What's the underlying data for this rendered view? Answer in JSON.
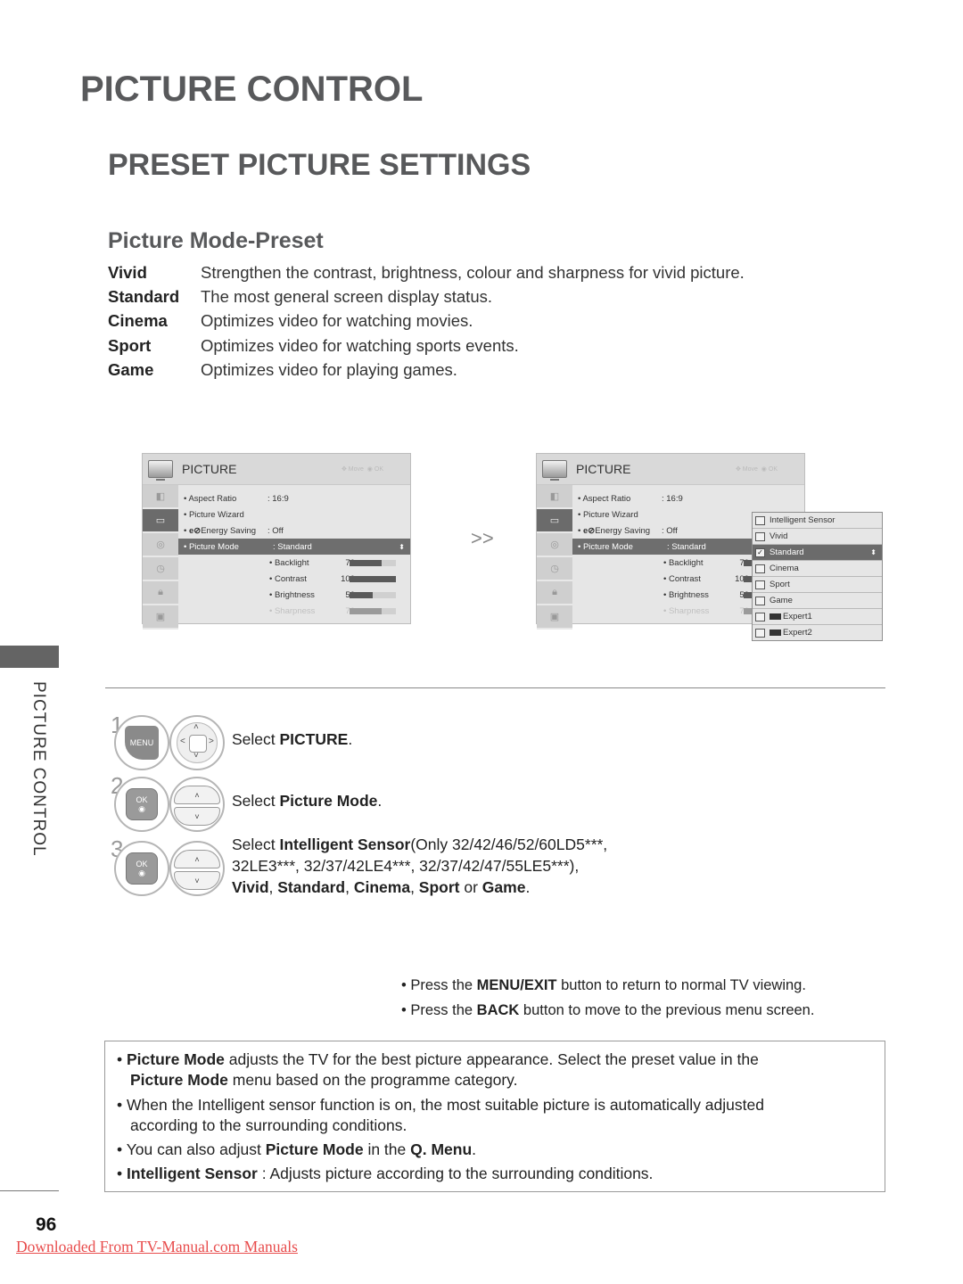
{
  "page": {
    "title": "PICTURE CONTROL",
    "section_title": "PRESET PICTURE SETTINGS",
    "subsection_title": "Picture Mode-Preset",
    "side_label": "PICTURE CONTROL",
    "page_number": "96",
    "footer_link": "Downloaded From TV-Manual.com Manuals"
  },
  "modes": [
    {
      "name": "Vivid",
      "desc": "Strengthen the contrast, brightness, colour and sharpness for vivid picture."
    },
    {
      "name": "Standard",
      "desc": "The most general screen display status."
    },
    {
      "name": "Cinema",
      "desc": "Optimizes video for watching movies."
    },
    {
      "name": "Sport",
      "desc": "Optimizes video for watching sports events."
    },
    {
      "name": "Game",
      "desc": "Optimizes video for playing games."
    }
  ],
  "osd": {
    "title": "PICTURE",
    "hint_move": "Move",
    "hint_ok": "OK",
    "items": [
      {
        "label": "Aspect Ratio",
        "value": ": 16:9"
      },
      {
        "label": "Picture Wizard",
        "value": ""
      },
      {
        "label": "Energy Saving",
        "value": ": Off"
      },
      {
        "label": "Picture Mode",
        "value": ": Standard"
      }
    ],
    "sub_items": [
      {
        "label": "Backlight",
        "value": "70",
        "level": 0.7
      },
      {
        "label": "Contrast",
        "value": "100",
        "level": 1.0
      },
      {
        "label": "Brightness",
        "value": "50",
        "level": 0.5
      },
      {
        "label": "Sharpness",
        "value": "70",
        "level": 0.7
      }
    ]
  },
  "popup": {
    "items": [
      {
        "label": "Intelligent Sensor",
        "checked": false
      },
      {
        "label": "Vivid",
        "checked": false
      },
      {
        "label": "Standard",
        "checked": true
      },
      {
        "label": "Cinema",
        "checked": false
      },
      {
        "label": "Sport",
        "checked": false
      },
      {
        "label": "Game",
        "checked": false
      },
      {
        "label": "Expert1",
        "checked": false
      },
      {
        "label": "Expert2",
        "checked": false
      }
    ]
  },
  "steps": [
    {
      "num": "1",
      "button": "MENU",
      "pre": "Select ",
      "bold": "PICTURE",
      "post": "."
    },
    {
      "num": "2",
      "button": "OK",
      "pre": "Select ",
      "bold": "Picture Mode",
      "post": "."
    },
    {
      "num": "3",
      "button": "OK",
      "line1_pre": "Select ",
      "line1_bold": "Intelligent Sensor",
      "line1_post": "(Only 32/42/46/52/60LD5***,",
      "line2": "32LE3***, 32/37/42LE4***, 32/37/42/47/55LE5***),",
      "line3": [
        {
          "t": "Vivid",
          "b": true
        },
        {
          "t": ", ",
          "b": false
        },
        {
          "t": "Standard",
          "b": true
        },
        {
          "t": ", ",
          "b": false
        },
        {
          "t": "Cinema",
          "b": true
        },
        {
          "t": ", ",
          "b": false
        },
        {
          "t": "Sport",
          "b": true
        },
        {
          "t": " or ",
          "b": false
        },
        {
          "t": "Game",
          "b": true
        },
        {
          "t": ".",
          "b": false
        }
      ]
    }
  ],
  "notes": [
    {
      "pre": "Press the ",
      "bold": "MENU/EXIT",
      "post": " button to return to normal TV viewing."
    },
    {
      "pre": "Press the ",
      "bold": "BACK",
      "post": " button to move to the previous menu screen."
    }
  ],
  "info_box": [
    {
      "parts": [
        {
          "t": "Picture Mode",
          "b": true
        },
        {
          "t": " adjusts the TV for the best picture appearance. Select the preset value in the",
          "b": false
        }
      ]
    },
    {
      "indent": true,
      "parts": [
        {
          "t": "Picture Mode",
          "b": true
        },
        {
          "t": " menu based on the programme category.",
          "b": false
        }
      ]
    },
    {
      "parts": [
        {
          "t": "When the Intelligent sensor function is on, the most suitable picture is automatically adjusted",
          "b": false
        }
      ]
    },
    {
      "indent": true,
      "parts": [
        {
          "t": "according to the surrounding conditions.",
          "b": false
        }
      ]
    },
    {
      "parts": [
        {
          "t": "You can also adjust ",
          "b": false
        },
        {
          "t": "Picture Mode",
          "b": true
        },
        {
          "t": " in the ",
          "b": false
        },
        {
          "t": "Q. Menu",
          "b": true
        },
        {
          "t": ".",
          "b": false
        }
      ]
    },
    {
      "parts": [
        {
          "t": "Intelligent Sensor",
          "b": true
        },
        {
          "t": " : Adjusts picture according to the surrounding conditions.",
          "b": false
        }
      ]
    }
  ]
}
